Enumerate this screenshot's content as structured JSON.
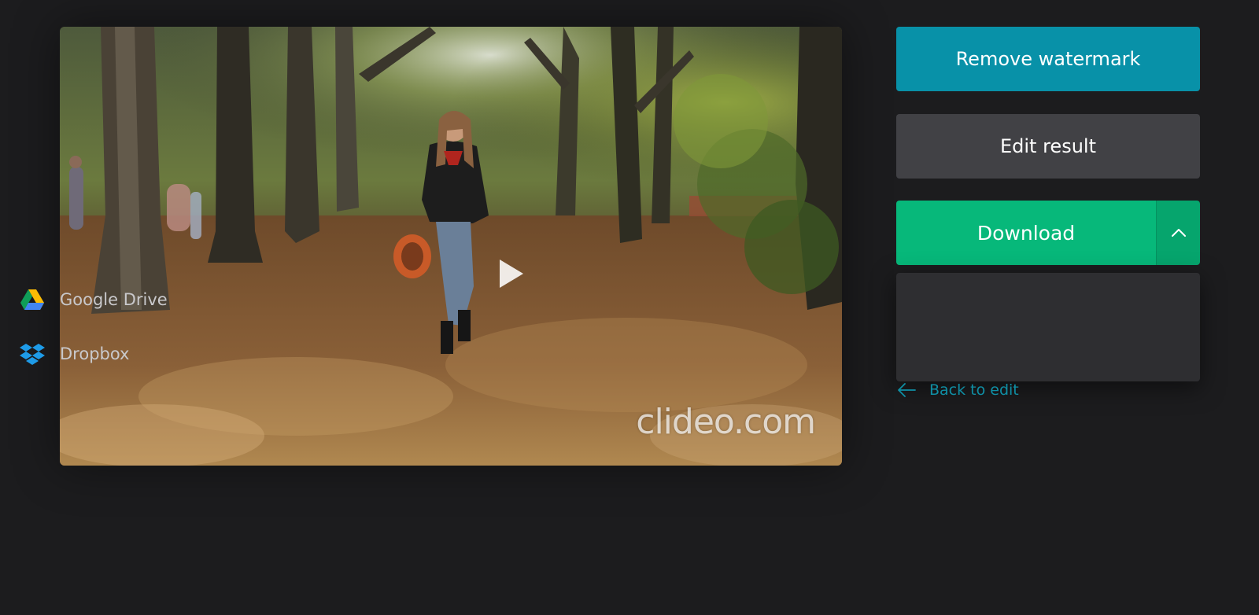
{
  "video": {
    "watermark_text": "clideo.com",
    "play_icon": "play-icon"
  },
  "actions": {
    "remove_watermark_label": "Remove watermark",
    "edit_result_label": "Edit result",
    "download_label": "Download",
    "download_toggle_icon": "chevron-up-icon"
  },
  "download_menu": {
    "items": [
      {
        "label": "Google Drive",
        "icon": "google-drive-icon"
      },
      {
        "label": "Dropbox",
        "icon": "dropbox-icon"
      }
    ]
  },
  "back_link": {
    "label": "Back to edit",
    "icon": "arrow-left-icon"
  },
  "colors": {
    "background": "#1c1c1e",
    "remove_watermark_button": "#0891a8",
    "edit_result_button": "#414145",
    "download_button": "#07b87a",
    "download_toggle": "#06a56d",
    "dropdown_bg": "#2e2e31",
    "link": "#0f8fa5"
  }
}
